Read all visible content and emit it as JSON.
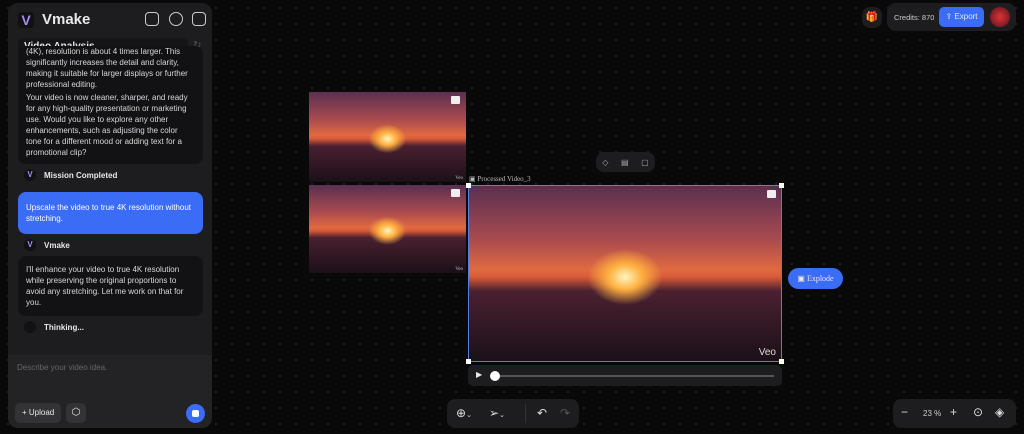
{
  "app": {
    "name": "Vmake",
    "conversation_title": "Video Analysis"
  },
  "chat": {
    "ai_message_1": "(4K), resolution is about 4 times larger. This significantly increases the detail and clarity, making it suitable for larger displays or further professional editing.",
    "ai_message_2": "Your video is now cleaner, sharper, and ready for any high-quality presentation or marketing use. Would you like to explore any other enhancements, such as adjusting the color tone for a different mood or adding text for a promotional clip?",
    "status_1": "Mission Completed",
    "user_message": "Upscale the video to true 4K resolution without stretching.",
    "sender": "Vmake",
    "ai_message_3": "I'll enhance your video to true 4K resolution while preserving the original proportions to avoid any stretching. Let me work on that for you.",
    "status_2": "Thinking...",
    "input_placeholder": "Describe your video idea.",
    "upload_label": "+ Upload"
  },
  "topbar": {
    "credits": "Credits: 870",
    "export_label": "Export"
  },
  "canvas": {
    "selected_label": "Processed Video_3",
    "watermark": "Veo",
    "explode_label": "Explode",
    "small_watermark": "Veo"
  },
  "zoom": {
    "value": "23",
    "unit": "%"
  },
  "colors": {
    "accent": "#3a6cf5",
    "selection": "#5a7de0"
  }
}
